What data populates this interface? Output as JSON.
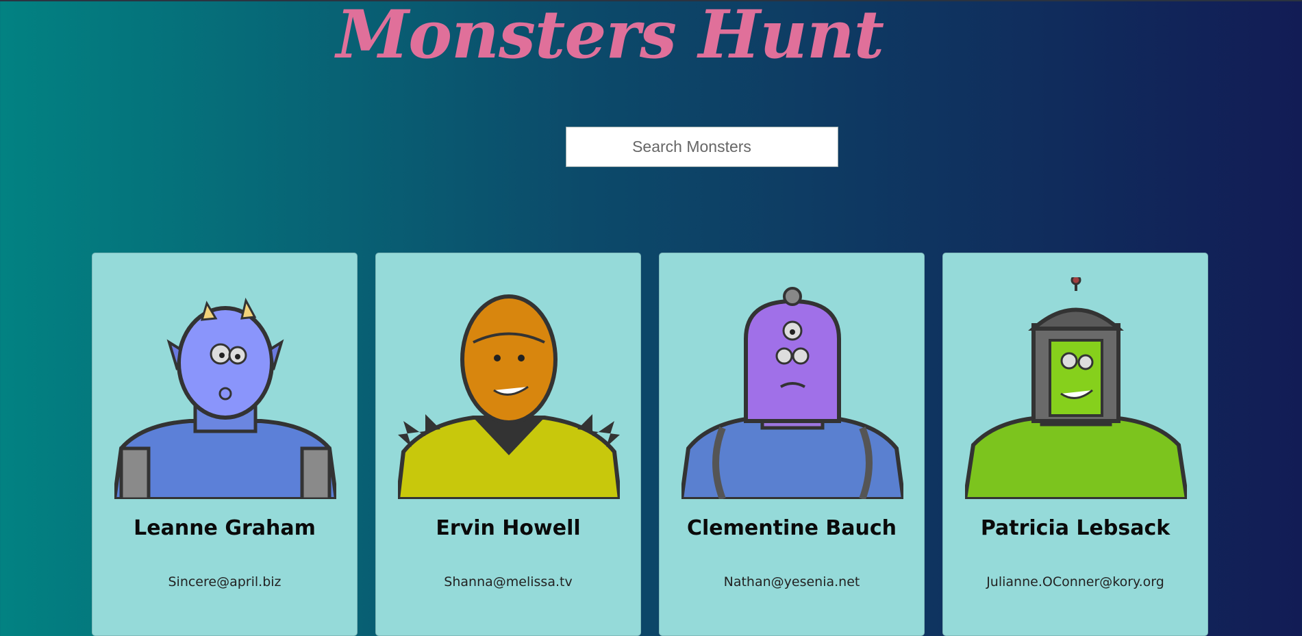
{
  "app": {
    "title": "Monsters Hunt"
  },
  "search": {
    "placeholder": "Search Monsters",
    "value": ""
  },
  "monsters": [
    {
      "name": "Leanne Graham",
      "email": "Sincere@april.biz",
      "color": "#7b8ff5",
      "body_color": "#5a7fd8",
      "icon": "horned-monster-icon"
    },
    {
      "name": "Ervin Howell",
      "email": "Shanna@melissa.tv",
      "color": "#d8860e",
      "body_color": "#c8c80a",
      "icon": "spiky-monster-icon"
    },
    {
      "name": "Clementine Bauch",
      "email": "Nathan@yesenia.net",
      "color": "#a878e8",
      "body_color": "#5a80d0",
      "icon": "three-eyed-monster-icon"
    },
    {
      "name": "Patricia Lebsack",
      "email": "Julianne.OConner@kory.org",
      "color": "#86d01c",
      "body_color": "#7cc41e",
      "icon": "helmet-monster-icon"
    }
  ]
}
